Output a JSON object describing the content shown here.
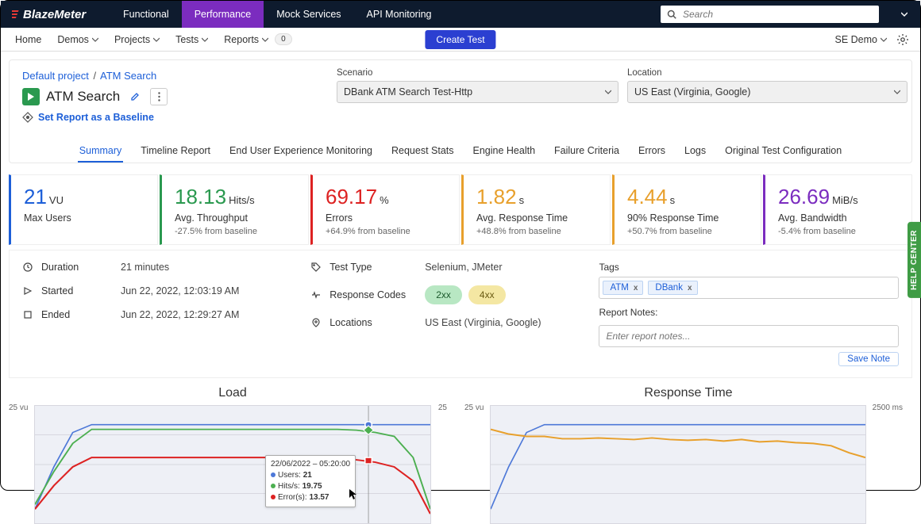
{
  "brand": "BlazeMeter",
  "nav1": {
    "items": [
      "Functional",
      "Performance",
      "Mock Services",
      "API Monitoring"
    ],
    "activeIndex": 1
  },
  "search": {
    "placeholder": "Search"
  },
  "nav2": {
    "items": [
      "Home",
      "Demos",
      "Projects",
      "Tests",
      "Reports"
    ],
    "reportsBadge": "0",
    "createTest": "Create Test",
    "account": "SE Demo"
  },
  "breadcrumb": {
    "project": "Default project",
    "test": "ATM Search"
  },
  "title": "ATM Search",
  "baselineLink": "Set Report as a Baseline",
  "scenario": {
    "label": "Scenario",
    "value": "DBank ATM Search Test-Http"
  },
  "location": {
    "label": "Location",
    "value": "US East (Virginia, Google)"
  },
  "tabs": [
    "Summary",
    "Timeline Report",
    "End User Experience Monitoring",
    "Request Stats",
    "Engine Health",
    "Failure Criteria",
    "Errors",
    "Logs",
    "Original Test Configuration"
  ],
  "activeTab": 0,
  "metrics": [
    {
      "color": "blue",
      "value": "21",
      "unit": "VU",
      "label": "Max Users",
      "delta": ""
    },
    {
      "color": "green",
      "value": "18.13",
      "unit": "Hits/s",
      "label": "Avg. Throughput",
      "delta": "-27.5% from baseline"
    },
    {
      "color": "red",
      "value": "69.17",
      "unit": "%",
      "label": "Errors",
      "delta": "+64.9% from baseline"
    },
    {
      "color": "orange",
      "value": "1.82",
      "unit": "s",
      "label": "Avg. Response Time",
      "delta": "+48.8% from baseline"
    },
    {
      "color": "orange",
      "value": "4.44",
      "unit": "s",
      "label": "90% Response Time",
      "delta": "+50.7% from baseline"
    },
    {
      "color": "purple",
      "value": "26.69",
      "unit": "MiB/s",
      "label": "Avg. Bandwidth",
      "delta": "-5.4% from baseline"
    }
  ],
  "info": {
    "duration": {
      "label": "Duration",
      "value": "21 minutes"
    },
    "started": {
      "label": "Started",
      "value": "Jun 22, 2022, 12:03:19 AM"
    },
    "ended": {
      "label": "Ended",
      "value": "Jun 22, 2022, 12:29:27 AM"
    },
    "testType": {
      "label": "Test Type",
      "value": "Selenium, JMeter"
    },
    "respCodes": {
      "label": "Response Codes"
    },
    "codes": [
      "2xx",
      "4xx"
    ],
    "locations": {
      "label": "Locations",
      "value": "US East (Virginia, Google)"
    }
  },
  "tags": {
    "label": "Tags",
    "items": [
      "ATM",
      "DBank"
    ]
  },
  "notes": {
    "label": "Report Notes:",
    "placeholder": "Enter report notes...",
    "save": "Save Note"
  },
  "charts": {
    "load": {
      "title": "Load",
      "yLeft": "25 vu",
      "yRight": "25"
    },
    "resp": {
      "title": "Response Time",
      "yLeft": "25 vu",
      "yRight": "2500 ms"
    }
  },
  "tooltip": {
    "time": "22/06/2022 – 05:20:00",
    "users_label": "Users:",
    "users": "21",
    "hits_label": "Hits/s:",
    "hits": "19.75",
    "errors_label": "Error(s):",
    "errors": "13.57"
  },
  "help": "HELP CENTER",
  "chart_data": [
    {
      "type": "line",
      "title": "Load",
      "ylim": [
        0,
        25
      ],
      "x": [
        0,
        1,
        2,
        3,
        4,
        5,
        6,
        7,
        8,
        9,
        10,
        11,
        12,
        13,
        14,
        15,
        16,
        17,
        18,
        19,
        20,
        21
      ],
      "series": [
        {
          "name": "Users",
          "color": "#4d78d8",
          "values": [
            3,
            9,
            15,
            21,
            21,
            21,
            21,
            21,
            21,
            21,
            21,
            21,
            21,
            21,
            21,
            21,
            21,
            21,
            21,
            21,
            21,
            21
          ]
        },
        {
          "name": "Hits/s",
          "color": "#4caf50",
          "values": [
            4,
            11,
            17,
            20,
            20,
            20,
            20,
            20,
            20,
            20,
            20,
            20,
            20,
            20,
            20,
            20,
            20,
            19.75,
            19,
            18,
            14,
            3
          ]
        },
        {
          "name": "Error(s)",
          "color": "#d22",
          "values": [
            3,
            8,
            12,
            14,
            14,
            14,
            14,
            14,
            14,
            14,
            14,
            14,
            14,
            14,
            14,
            14,
            14,
            13.57,
            13,
            12,
            9,
            2
          ]
        }
      ],
      "tooltip_point": {
        "x": 17,
        "Users": 21,
        "Hits/s": 19.75,
        "Error(s)": 13.57,
        "time": "22/06/2022 – 05:20:00"
      }
    },
    {
      "type": "line",
      "title": "Response Time",
      "y_left_lim": [
        0,
        25
      ],
      "y_right_lim": [
        0,
        2500
      ],
      "x": [
        0,
        1,
        2,
        3,
        4,
        5,
        6,
        7,
        8,
        9,
        10,
        11,
        12,
        13,
        14,
        15,
        16,
        17,
        18,
        19,
        20,
        21
      ],
      "series": [
        {
          "name": "Users",
          "axis": "left",
          "color": "#4d78d8",
          "values": [
            3,
            9,
            15,
            21,
            21,
            21,
            21,
            21,
            21,
            21,
            21,
            21,
            21,
            21,
            21,
            21,
            21,
            21,
            21,
            21,
            21,
            21
          ]
        },
        {
          "name": "Avg Response Time (ms)",
          "axis": "right",
          "color": "#e8a02c",
          "values": [
            2000,
            1900,
            1850,
            1850,
            1800,
            1800,
            1820,
            1800,
            1780,
            1820,
            1780,
            1770,
            1780,
            1760,
            1780,
            1740,
            1750,
            1730,
            1700,
            1650,
            1500,
            1400
          ]
        }
      ]
    }
  ]
}
